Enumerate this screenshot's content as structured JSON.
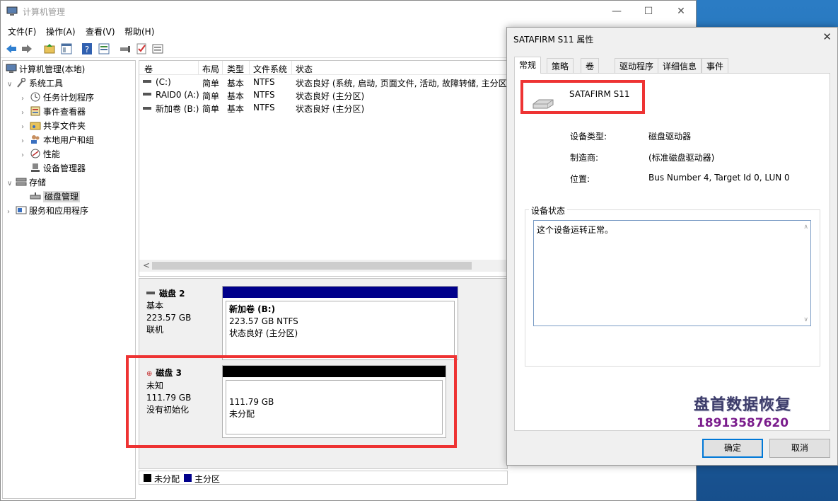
{
  "window": {
    "title": "计算机管理",
    "controls": {
      "minimize": "—",
      "maximize": "☐",
      "close": "✕"
    }
  },
  "menu": [
    "文件(F)",
    "操作(A)",
    "查看(V)",
    "帮助(H)"
  ],
  "toolbar": {
    "icons": [
      "back-arrow-icon",
      "forward-arrow-icon",
      "up-folder-icon",
      "show-hide-tree-icon",
      "help-icon",
      "properties-icon",
      "connect-icon",
      "check-icon",
      "export-list-icon"
    ]
  },
  "tree": {
    "root": "计算机管理(本地)",
    "system_tools": "系统工具",
    "task_scheduler": "任务计划程序",
    "event_viewer": "事件查看器",
    "shared_folders": "共享文件夹",
    "local_users": "本地用户和组",
    "performance": "性能",
    "device_manager": "设备管理器",
    "storage": "存储",
    "disk_management": "磁盘管理",
    "services_apps": "服务和应用程序"
  },
  "volume_list": {
    "headers": {
      "volume": "卷",
      "layout": "布局",
      "type": "类型",
      "fs": "文件系统",
      "status": "状态"
    },
    "rows": [
      {
        "volume": "(C:)",
        "layout": "简单",
        "type": "基本",
        "fs": "NTFS",
        "status": "状态良好 (系统, 启动, 页面文件, 活动, 故障转储, 主分区)"
      },
      {
        "volume": "RAID0 (A:)",
        "layout": "简单",
        "type": "基本",
        "fs": "NTFS",
        "status": "状态良好 (主分区)"
      },
      {
        "volume": "新加卷 (B:)",
        "layout": "简单",
        "type": "基本",
        "fs": "NTFS",
        "status": "状态良好 (主分区)"
      }
    ],
    "scroll_left": "<"
  },
  "disks": {
    "disk2": {
      "name": "磁盘 2",
      "type": "基本",
      "size": "223.57 GB",
      "state": "联机",
      "partition": {
        "name": "新加卷 (B:)",
        "size": "223.57 GB NTFS",
        "status": "状态良好 (主分区)"
      }
    },
    "disk3": {
      "name": "磁盘 3",
      "type": "未知",
      "size": "111.79 GB",
      "state": "没有初始化",
      "partition": {
        "size": "111.79 GB",
        "status": "未分配"
      }
    }
  },
  "legend": {
    "unallocated": "未分配",
    "primary": "主分区"
  },
  "colors": {
    "primary_partition": "#00008b",
    "unallocated": "#000000",
    "highlight": "#ee3333"
  },
  "dialog": {
    "title": "SATAFIRM   S11 属性",
    "close": "✕",
    "tabs": [
      "常规",
      "策略",
      "卷",
      "驱动程序",
      "详细信息",
      "事件"
    ],
    "device_name": "SATAFIRM   S11",
    "device_type_label": "设备类型:",
    "device_type": "磁盘驱动器",
    "manufacturer_label": "制造商:",
    "manufacturer": "(标准磁盘驱动器)",
    "location_label": "位置:",
    "location": "Bus Number 4, Target Id 0, LUN 0",
    "status_group": "设备状态",
    "status_text": "这个设备运转正常。",
    "watermark_line1": "盘首数据恢复",
    "watermark_line2": "18913587620",
    "ok": "确定",
    "cancel": "取消"
  }
}
